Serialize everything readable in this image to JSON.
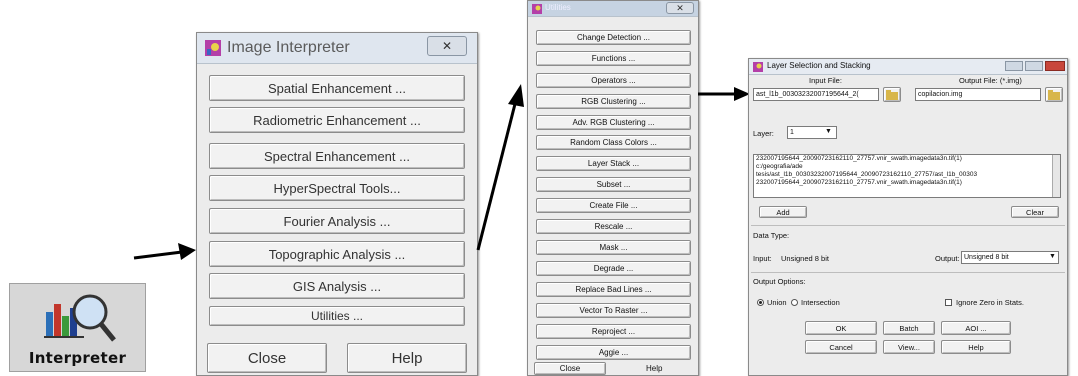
{
  "icon": {
    "label": "Interpreter",
    "name": "interpreter-icon"
  },
  "image_interpreter": {
    "title": "Image Interpreter",
    "buttons": [
      "Spatial Enhancement ...",
      "Radiometric Enhancement ...",
      "Spectral Enhancement ...",
      "HyperSpectral Tools...",
      "Fourier Analysis ...",
      "Topographic Analysis ...",
      "GIS Analysis ...",
      "Utilities ..."
    ],
    "close_label": "Close",
    "help_label": "Help"
  },
  "utilities": {
    "title": "Utilities",
    "buttons": [
      "Change Detection ...",
      "Functions ...",
      "Operators ...",
      "RGB Clustering ...",
      "Adv. RGB Clustering ...",
      "Random Class Colors ...",
      "Layer Stack ...",
      "Subset ...",
      "Create File ...",
      "Rescale ...",
      "Mask ...",
      "Degrade ...",
      "Replace Bad Lines ...",
      "Vector To Raster ...",
      "Reproject ...",
      "Aggie ..."
    ],
    "close_label": "Close",
    "help_label": "Help"
  },
  "layer_selection": {
    "title": "Layer Selection and Stacking",
    "input_file_label": "Input File:",
    "output_file_label": "Output File: (*.img)",
    "input_file_value": "ast_l1b_00303232007195644_2(",
    "output_file_value": "copilacion.img",
    "layer_label": "Layer:",
    "layer_value": "1",
    "list_lines": [
      "232007195644_20090723162110_27757.vnir_swath.imagedata3n.tif(1)",
      "c:/geografia/ade",
      "tesis/ast_l1b_00303232007195644_20090723162110_27757/ast_l1b_00303",
      "232007195644_20090723162110_27757.vnir_swath.imagedata3n.tif(1)"
    ],
    "add_label": "Add",
    "clear_label": "Clear",
    "data_type_label": "Data Type:",
    "input_label": "Input:",
    "input_type_value": "Unsigned 8 bit",
    "output_label": "Output:",
    "output_type_value": "Unsigned 8 bit",
    "output_options_label": "Output Options:",
    "union_label": "Union",
    "intersection_label": "Intersection",
    "ignore_zero_label": "Ignore Zero in Stats.",
    "ok_label": "OK",
    "batch_label": "Batch",
    "aoi_label": "AOI ...",
    "cancel_label": "Cancel",
    "view_label": "View...",
    "help_label": "Help"
  }
}
